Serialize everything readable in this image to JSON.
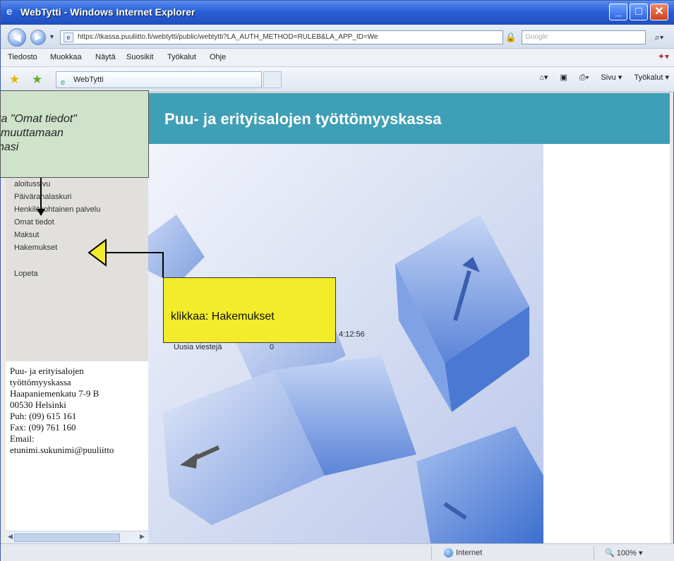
{
  "window": {
    "title": "WebTytti - Windows Internet Explorer",
    "minimize": "_",
    "maximize": "□",
    "close": "✕"
  },
  "address_bar": {
    "url": "https://tkassa.puuliitto.fi/webtytti/public/webtytti?LA_AUTH_METHOD=RULEB&LA_APP_ID=We",
    "search_placeholder": "Google",
    "back_icon": "back-arrow-icon",
    "forward_icon": "forward-arrow-icon"
  },
  "menubar": {
    "items": [
      "Tiedosto",
      "Muokkaa",
      "Näytä",
      "Suosikit",
      "Työkalut",
      "Ohje"
    ]
  },
  "tabbar": {
    "tab_label": "WebTytti",
    "commands": [
      "Sivu ▾",
      "Työkalut ▾"
    ]
  },
  "page": {
    "header_title": "Puu- ja erityisalojen työttömyyskassa",
    "nav_links": [
      "aloitussivu",
      "Päivärahalaskuri",
      "Henkilökohtainen palvelu",
      "Omat tiedot",
      "Maksut",
      "Hakemukset"
    ],
    "logout": "Lopeta",
    "info_time": "4:12:56",
    "info_messages_label": "Uusia viestejä",
    "info_messages_count": "0",
    "contact_lines": [
      "Puu- ja erityisalojen",
      "työttömyyskassa",
      "Haapaniemenkatu 7-9 B",
      "00530 Helsinki",
      "Puh: (09) 615 161",
      "Fax: (09) 761 160",
      "Email:",
      "etunimi.sukunimi@puuliitto"
    ]
  },
  "annotations": {
    "green_callout_lines": [
      "sta \"Omat tiedot\"",
      "muuttamaan",
      "nasi"
    ],
    "yellow_callout": "klikkaa: Hakemukset"
  },
  "statusbar": {
    "zone": "Internet",
    "zoom": "100%"
  },
  "colors": {
    "header_teal": "#3f9fb6",
    "callout_green": "#cfe3cb",
    "callout_yellow": "#f2ec2a",
    "titlebar_blue": "#2a5fd6"
  }
}
